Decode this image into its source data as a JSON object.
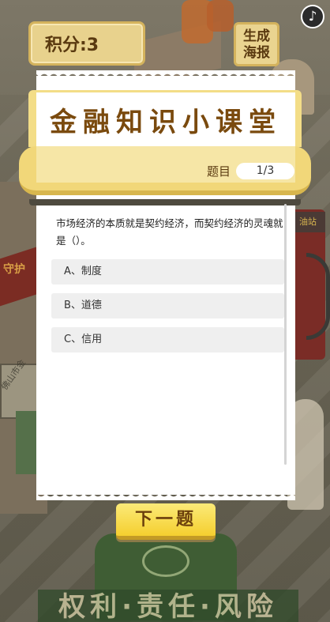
{
  "score": {
    "label": "积分:3"
  },
  "poster_button": {
    "line1": "生成",
    "line2": "海报"
  },
  "music_button": {
    "icon": "music-note-icon",
    "glyph": "♪"
  },
  "quiz": {
    "title": "金融知识小课堂",
    "progress_label": "题目",
    "progress_value": "1/3",
    "question": "市场经济的本质就是契约经济，而契约经济的灵魂就是（）。",
    "options": [
      {
        "label": "A、制度"
      },
      {
        "label": "B、道德"
      },
      {
        "label": "C、信用"
      }
    ],
    "next_button": "下一题"
  },
  "background": {
    "banner_text": "守护",
    "sign_text": "佛山市金",
    "pump_text": "油站",
    "emblem_text": "权利·责任·风险"
  },
  "colors": {
    "accent_yellow": "#f5cf2f",
    "title_brown": "#7a4a0e",
    "header_gold": "#f1d779"
  }
}
